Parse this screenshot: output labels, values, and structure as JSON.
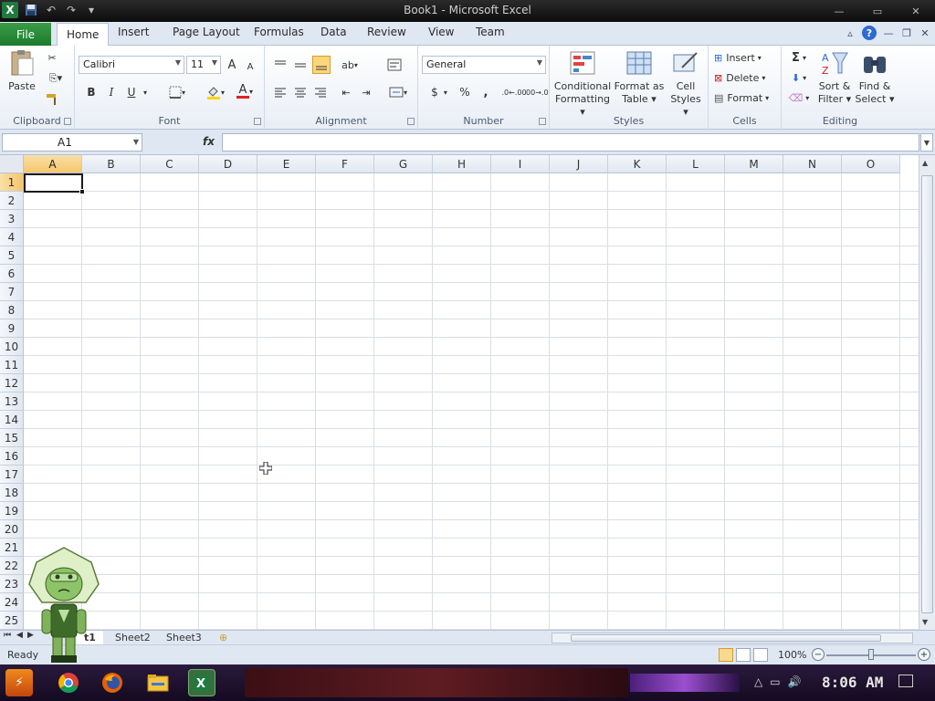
{
  "window": {
    "title": "Book1 - Microsoft Excel",
    "app_icon": "X",
    "minimize": "—",
    "restore": "▭",
    "close": "✕"
  },
  "ribbon_tabs": [
    "File",
    "Home",
    "Insert",
    "Page Layout",
    "Formulas",
    "Data",
    "Review",
    "View",
    "Team"
  ],
  "ribbon": {
    "clipboard": {
      "label": "Clipboard",
      "paste": "Paste"
    },
    "font": {
      "label": "Font",
      "font_name": "Calibri",
      "font_size": "11",
      "bold": "B",
      "italic": "I",
      "underline": "U",
      "grow": "A",
      "shrink": "A",
      "font_color": "A"
    },
    "alignment": {
      "label": "Alignment"
    },
    "number": {
      "label": "Number",
      "format": "General",
      "currency": "$",
      "percent": "%",
      "comma": ",",
      "inc_dec": ".0←.00",
      "dec_dec": ".00→.0"
    },
    "styles": {
      "label": "Styles",
      "conditional": [
        "Conditional",
        "Formatting"
      ],
      "format_table": [
        "Format as",
        "Table"
      ],
      "cell_styles": [
        "Cell",
        "Styles"
      ]
    },
    "cells": {
      "label": "Cells",
      "insert": "Insert",
      "delete": "Delete",
      "format": "Format"
    },
    "editing": {
      "label": "Editing",
      "sum": "Σ",
      "sort_filter": [
        "Sort &",
        "Filter"
      ],
      "find_select": [
        "Find &",
        "Select"
      ]
    }
  },
  "formula_bar": {
    "name_box": "A1",
    "fx": "fx",
    "value": ""
  },
  "columns": [
    "A",
    "B",
    "C",
    "D",
    "E",
    "F",
    "G",
    "H",
    "I",
    "J",
    "K",
    "L",
    "M",
    "N",
    "O"
  ],
  "rows": [
    "1",
    "2",
    "3",
    "4",
    "5",
    "6",
    "7",
    "8",
    "9",
    "10",
    "11",
    "12",
    "13",
    "14",
    "15",
    "16",
    "17",
    "18",
    "19",
    "20",
    "21",
    "22",
    "23",
    "24",
    "25"
  ],
  "active_cell": "A1",
  "sheets": [
    "t1",
    "Sheet2",
    "Sheet3"
  ],
  "status": {
    "text": "Ready",
    "zoom": "100%",
    "zoom_minus": "−",
    "zoom_plus": "+"
  },
  "taskbar": {
    "clock": "8:06 AM"
  },
  "colors": {
    "accent": "#217346",
    "file_tab": "#2a8c3a",
    "selection": "#f5c66a"
  }
}
